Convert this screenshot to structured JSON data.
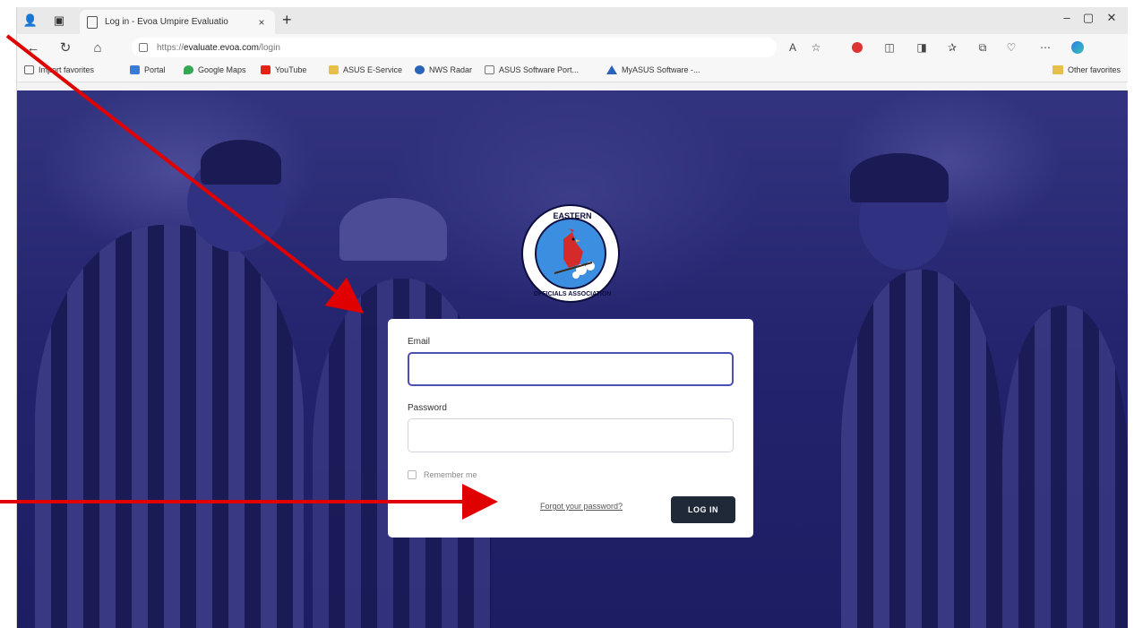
{
  "browser": {
    "tab_title": "Log in - Evoa Umpire Evaluatio",
    "tab_close": "×",
    "new_tab": "+",
    "url_scheme": "https://",
    "url_host": "evaluate.evoa.com",
    "url_path": "/login",
    "window_controls": {
      "minimize": "–",
      "maximize": "▢",
      "close": "✕"
    }
  },
  "favorites": {
    "items": [
      {
        "label": "Import favorites",
        "color": "#666666"
      },
      {
        "label": "Portal",
        "color": "#3a7bd5"
      },
      {
        "label": "Google Maps",
        "color": "#34a853"
      },
      {
        "label": "YouTube",
        "color": "#e62117"
      },
      {
        "label": "ASUS E-Service",
        "color": "#e7c04a"
      },
      {
        "label": "NWS Radar",
        "color": "#2a64b8"
      },
      {
        "label": "ASUS Software Port...",
        "color": "#777777"
      },
      {
        "label": "MyASUS Software -...",
        "color": "#2a64b8"
      }
    ],
    "other": "Other favorites"
  },
  "logo": {
    "top_text": "EASTERN",
    "bottom_text": "OFFICIALS ASSOCIATION"
  },
  "login": {
    "email_label": "Email",
    "email_value": "",
    "password_label": "Password",
    "password_value": "",
    "remember_label": "Remember me",
    "forgot_link": "Forgot your password?",
    "submit": "LOG IN"
  },
  "annotation_color": "#e00000"
}
